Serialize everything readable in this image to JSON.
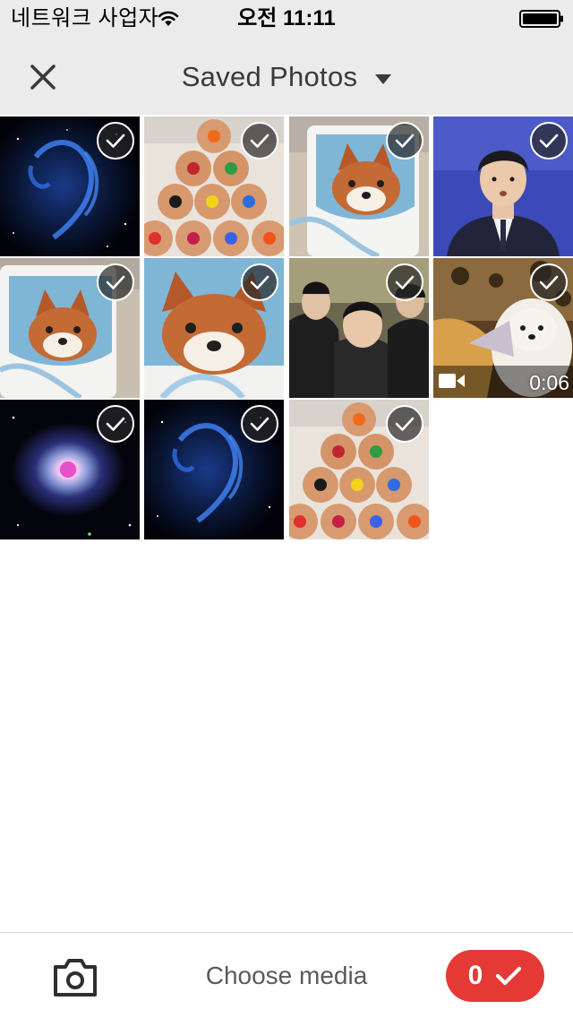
{
  "status_bar": {
    "carrier": "네트워크 사업자",
    "time": "오전 11:11",
    "icons": [
      "wifi-icon",
      "battery-icon"
    ]
  },
  "nav": {
    "close_icon": "close-icon",
    "title": "Saved Photos",
    "dropdown_icon": "dropdown-arrow-icon"
  },
  "photos": [
    {
      "subject": "space-nebula-blue",
      "selected": false
    },
    {
      "subject": "colored-pencils",
      "selected": false
    },
    {
      "subject": "red-panda-mug",
      "selected": false
    },
    {
      "subject": "person-portrait",
      "selected": false
    },
    {
      "subject": "red-panda-mug",
      "selected": false
    },
    {
      "subject": "red-panda-mug-closeup",
      "selected": false
    },
    {
      "subject": "group-selfie",
      "selected": false
    },
    {
      "subject": "dog-video",
      "selected": false,
      "is_video": true,
      "duration": "0:06"
    },
    {
      "subject": "helix-nebula",
      "selected": false
    },
    {
      "subject": "space-nebula-blue",
      "selected": false
    },
    {
      "subject": "colored-pencils",
      "selected": false
    }
  ],
  "bottom_bar": {
    "camera_icon": "camera-icon",
    "label": "Choose media",
    "selected_count": "0",
    "confirm_icon": "checkmark-icon",
    "accent_color": "#e53935"
  }
}
